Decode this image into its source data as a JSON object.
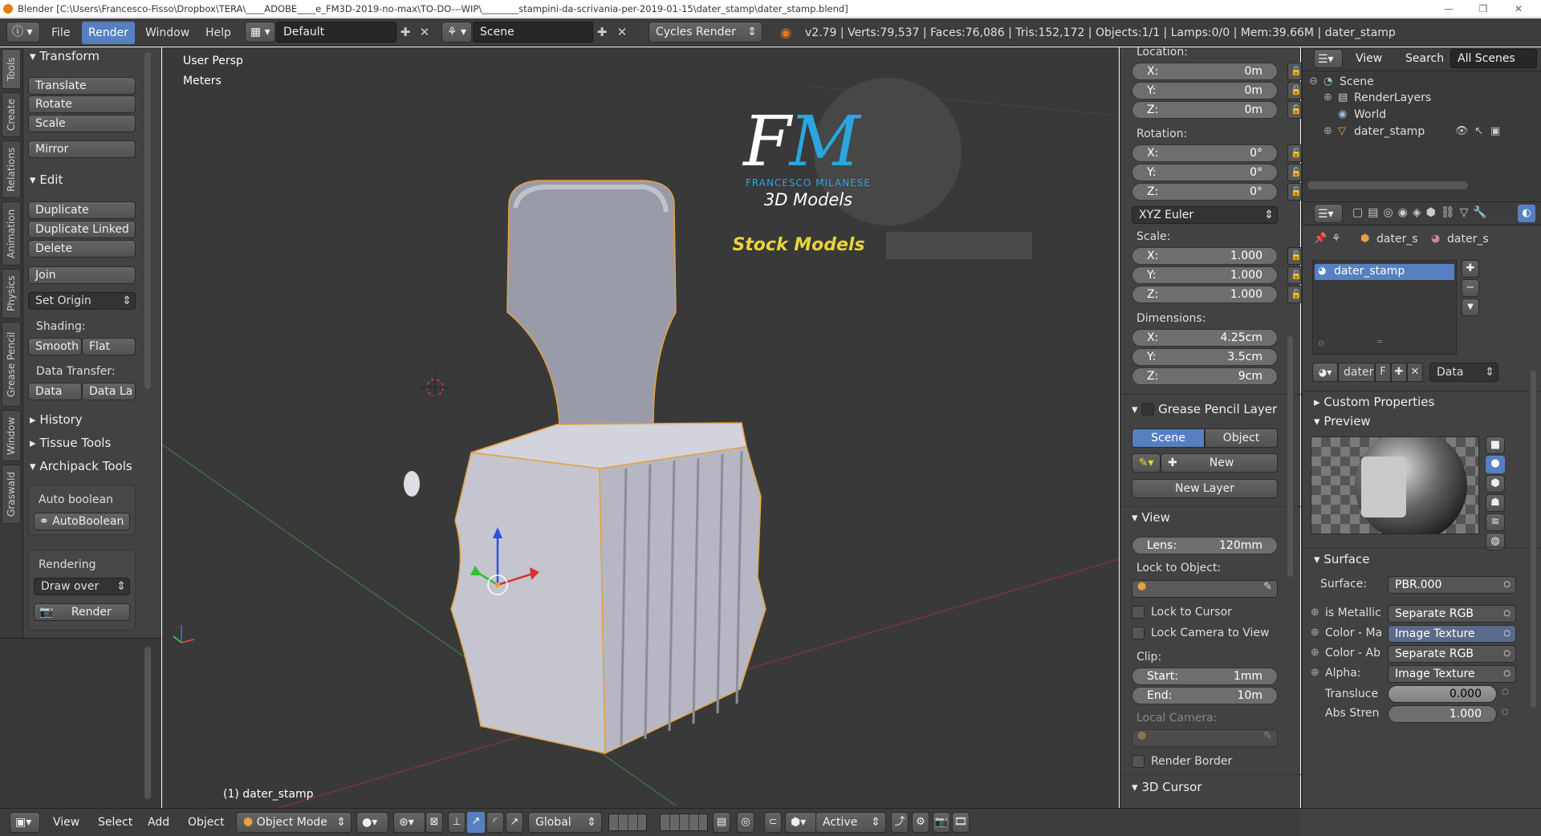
{
  "title_bar": {
    "text": "Blender [C:\\Users\\Francesco-Fisso\\Dropbox\\TERA\\____ADOBE____e_FM3D-2019-no-max\\TO-DO---WIP\\________stampini-da-scrivania-per-2019-01-15\\dater_stamp\\dater_stamp.blend]",
    "minimize": "—",
    "maximize": "❐",
    "close": "✕"
  },
  "menu": {
    "file": "File",
    "render": "Render",
    "window": "Window",
    "help": "Help",
    "layout": "Default",
    "scene": "Scene",
    "engine": "Cycles Render",
    "stats": "v2.79 | Verts:79,537 | Faces:76,086 | Tris:152,172 | Objects:1/1 | Lamps:0/0 | Mem:39.66M | dater_stamp"
  },
  "left_tabs": [
    "Tools",
    "Create",
    "Relations",
    "Animation",
    "Physics",
    "Grease Pencil",
    "Window",
    "Graswald"
  ],
  "toolshelf": {
    "transform": {
      "header": "Transform",
      "translate": "Translate",
      "rotate": "Rotate",
      "scale": "Scale",
      "mirror": "Mirror"
    },
    "edit": {
      "header": "Edit",
      "duplicate": "Duplicate",
      "duplicate_linked": "Duplicate Linked",
      "delete": "Delete",
      "join": "Join",
      "set_origin": "Set Origin",
      "shading_label": "Shading:",
      "smooth": "Smooth",
      "flat": "Flat",
      "data_transfer_label": "Data Transfer:",
      "data": "Data",
      "data_la": "Data La"
    },
    "history": "History",
    "tissue_tools": "Tissue Tools",
    "archipack": {
      "header": "Archipack Tools",
      "auto_boolean_label": "Auto boolean",
      "autoboolean_btn": "AutoBoolean",
      "rendering_label": "Rendering",
      "draw_over": "Draw over",
      "render_btn": "Render"
    }
  },
  "viewport": {
    "view_name": "User Persp",
    "units": "Meters",
    "object_label": "(1) dater_stamp",
    "logo": {
      "letters": "FM",
      "name": "FRANCESCO MILANESE",
      "sub": "3D Models",
      "stock": "Stock Models"
    }
  },
  "properties_panel": {
    "location_label": "Location:",
    "location": [
      {
        "k": "X:",
        "v": "0m"
      },
      {
        "k": "Y:",
        "v": "0m"
      },
      {
        "k": "Z:",
        "v": "0m"
      }
    ],
    "rotation_label": "Rotation:",
    "rotation": [
      {
        "k": "X:",
        "v": "0°"
      },
      {
        "k": "Y:",
        "v": "0°"
      },
      {
        "k": "Z:",
        "v": "0°"
      }
    ],
    "rotation_mode": "XYZ Euler",
    "scale_label": "Scale:",
    "scale": [
      {
        "k": "X:",
        "v": "1.000"
      },
      {
        "k": "Y:",
        "v": "1.000"
      },
      {
        "k": "Z:",
        "v": "1.000"
      }
    ],
    "dimensions_label": "Dimensions:",
    "dimensions": [
      {
        "k": "X:",
        "v": "4.25cm"
      },
      {
        "k": "Y:",
        "v": "3.5cm"
      },
      {
        "k": "Z:",
        "v": "9cm"
      }
    ],
    "grease_pencil": {
      "header": "Grease Pencil Layer",
      "scene": "Scene",
      "object": "Object",
      "new": "New",
      "new_layer": "New Layer"
    },
    "view": {
      "header": "View",
      "lens_label": "Lens:",
      "lens_value": "120mm",
      "lock_to_object": "Lock to Object:",
      "lock_to_cursor": "Lock to Cursor",
      "lock_camera": "Lock Camera to View",
      "clip_label": "Clip:",
      "start_label": "Start:",
      "start_value": "1mm",
      "end_label": "End:",
      "end_value": "10m",
      "local_camera": "Local Camera:",
      "render_border": "Render Border"
    },
    "cursor_header": "3D Cursor"
  },
  "outliner": {
    "view": "View",
    "search": "Search",
    "scope": "All Scenes",
    "items": [
      "Scene",
      "RenderLayers",
      "World",
      "dater_stamp"
    ]
  },
  "material": {
    "breadcrumb_1": "dater_s",
    "breadcrumb_2": "dater_s",
    "slot": "dater_stamp",
    "mat_name": "dater",
    "f_label": "F",
    "link": "Data",
    "custom_props": "Custom Properties",
    "preview": "Preview",
    "surface_header": "Surface",
    "surface_label": "Surface:",
    "surface_value": "PBR.000",
    "inputs": [
      {
        "k": "is Metallic",
        "v": "Separate RGB"
      },
      {
        "k": "Color - Ma",
        "v": "Image Texture"
      },
      {
        "k": "Color - Ab",
        "v": "Separate RGB"
      },
      {
        "k": "Alpha:",
        "v": "Image Texture"
      }
    ],
    "transluce_label": "Transluce",
    "transluce_value": "0.000",
    "abs_label": "Abs Stren",
    "abs_value": "1.000"
  },
  "bottom_bar": {
    "view": "View",
    "select": "Select",
    "add": "Add",
    "object": "Object",
    "mode": "Object Mode",
    "orientation": "Global",
    "snap": "Active"
  },
  "colors": {
    "accent": "#5680c2",
    "bg_dark": "#393939",
    "panel": "#424242",
    "logo_blue": "#2aa6e0",
    "logo_yellow": "#e8d43a",
    "selection_orange": "#f0a040"
  }
}
